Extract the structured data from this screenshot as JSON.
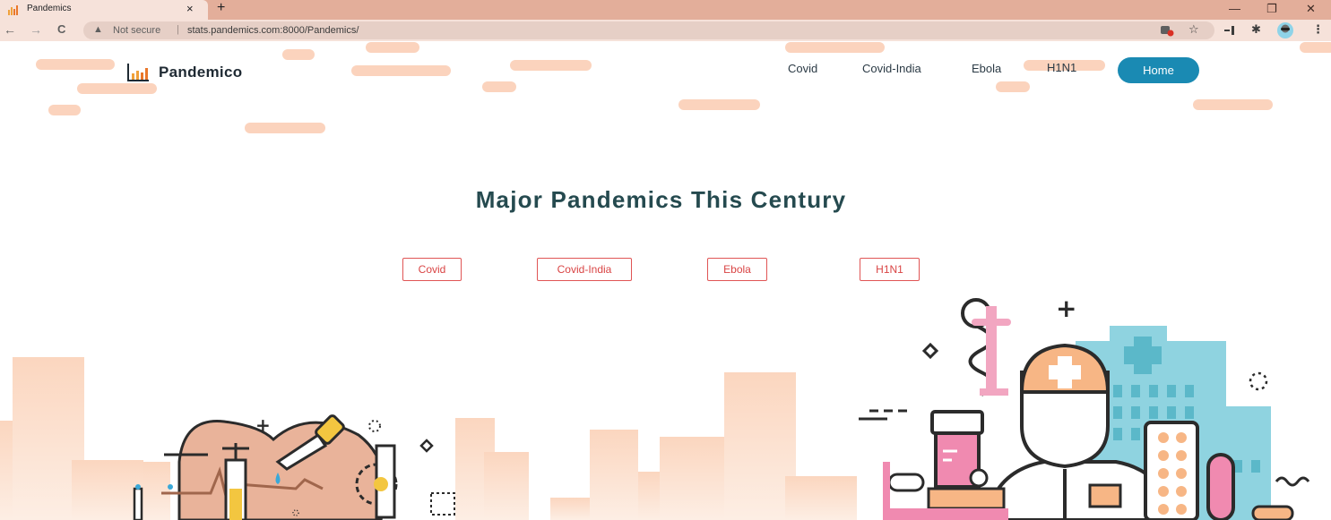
{
  "browser": {
    "tab_title": "Pandemics",
    "tab_close": "×",
    "new_tab": "+",
    "minimize": "—",
    "restore": "❐",
    "close": "✕",
    "back": "←",
    "forward": "→",
    "reload": "C",
    "security_icon": "▲",
    "security_text": "Not secure",
    "separator": "|",
    "url": "stats.pandemics.com:8000/Pandemics/",
    "star": "☆",
    "puzzle": "✱",
    "menu": "⋮"
  },
  "header": {
    "brand_name": "Pandemico",
    "nav": [
      "Covid",
      "Covid-India",
      "Ebola",
      "H1N1"
    ],
    "home_label": "Home"
  },
  "hero": {
    "title": "Major Pandemics This Century",
    "buttons": [
      "Covid",
      "Covid-India",
      "Ebola",
      "H1N1"
    ]
  },
  "colors": {
    "accent": "#1a8ab3",
    "outline_red": "#e05555",
    "pill_peach": "#fbd3bd",
    "title_teal": "#254a4f"
  }
}
